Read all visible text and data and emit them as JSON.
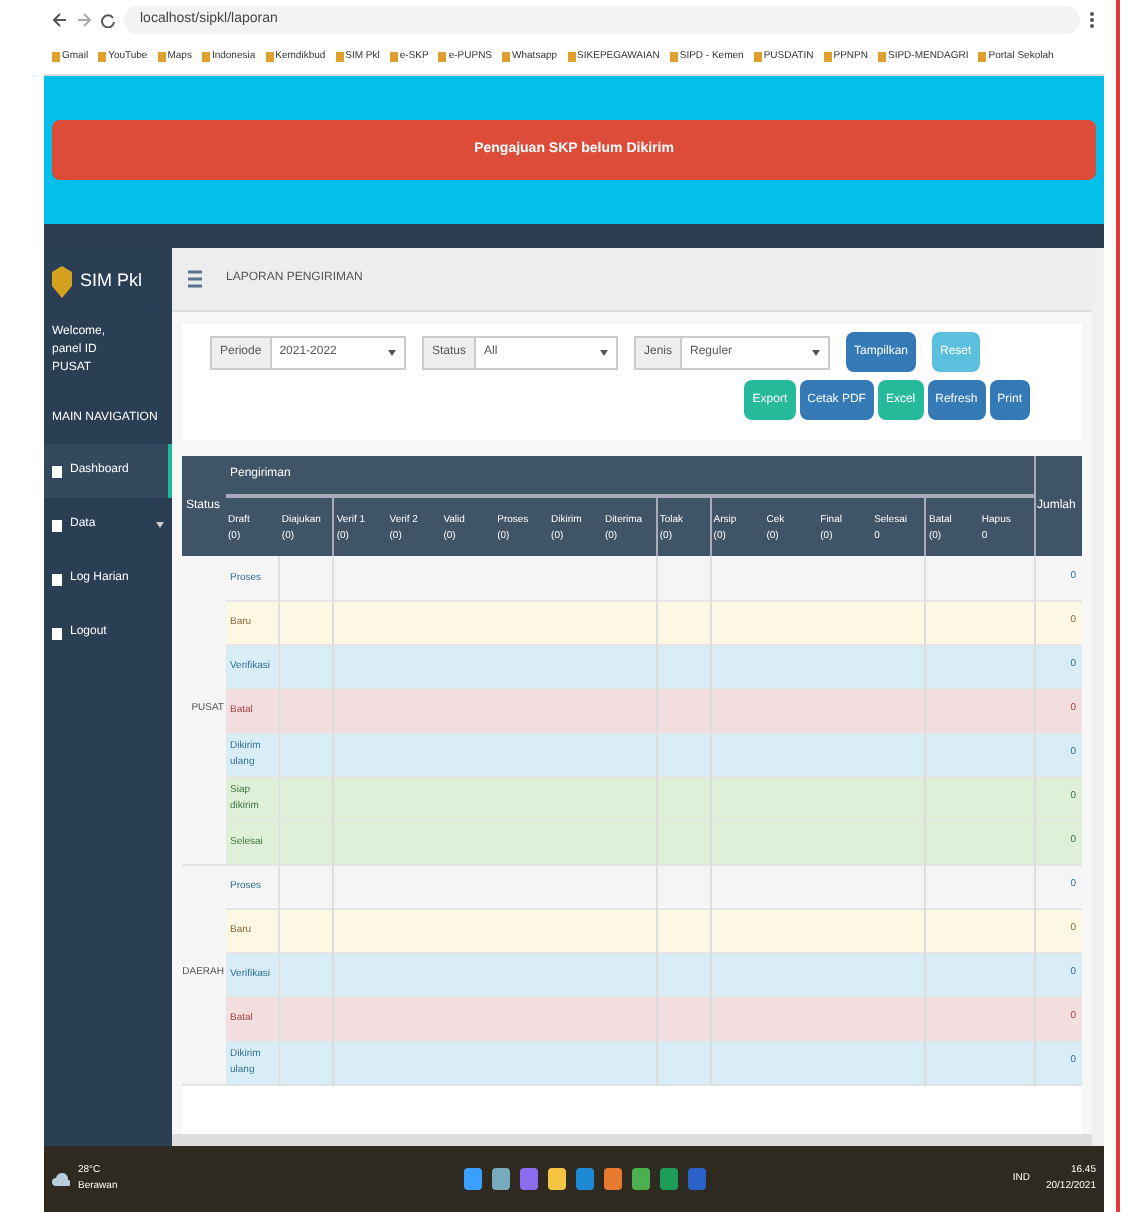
{
  "browser": {
    "url": "localhost/sipkl/laporan",
    "bookmarks": [
      "Gmail",
      "YouTube",
      "Maps",
      "Indonesia",
      "Kemdikbud",
      "SIM Pkl",
      "e-SKP",
      "e-PUPNS",
      "Whatsapp",
      "SIKEPEGAWAIAN",
      "SIPD - Kemen",
      "PUSDATIN",
      "PPNPN",
      "SIPD-MENDAGRI",
      "Portal Sekolah"
    ]
  },
  "alert": {
    "text": "Pengajuan SKP belum Dikirim"
  },
  "sidebar": {
    "brand": "SIM Pkl",
    "user": [
      "Welcome,",
      "panel ID",
      "PUSAT"
    ],
    "section": "MAIN NAVIGATION",
    "items": [
      {
        "label": "Dashboard",
        "selected": true,
        "kind": "link"
      },
      {
        "label": "Data",
        "selected": false,
        "kind": "dropdown"
      },
      {
        "label": "Log Harian",
        "selected": false,
        "kind": "link"
      },
      {
        "label": "Logout",
        "selected": false,
        "kind": "link"
      }
    ]
  },
  "page_title": "LAPORAN PENGIRIMAN",
  "filters": [
    {
      "label": "Periode",
      "value": "2021-2022"
    },
    {
      "label": "Status",
      "value": "All"
    },
    {
      "label": "Jenis",
      "value": "Reguler"
    }
  ],
  "buttons": [
    {
      "label": "Tampilkan",
      "color": "#337ab7"
    },
    {
      "label": "Reset",
      "color": "#5bc0de"
    },
    {
      "label": "Export",
      "color": "#26b99a"
    },
    {
      "label": "Cetak PDF",
      "color": "#337ab7"
    },
    {
      "label": "Excel",
      "color": "#26b99a"
    },
    {
      "label": "Refresh",
      "color": "#337ab7"
    },
    {
      "label": "Print",
      "color": "#337ab7"
    }
  ],
  "table": {
    "status_header": "Status",
    "group_header": "Pengiriman",
    "total_header": "Jumlah",
    "columns": [
      {
        "label": "Draft",
        "count": "(0)"
      },
      {
        "label": "Diajukan",
        "count": "(0)"
      },
      {
        "label": "Verif 1",
        "count": "(0)"
      },
      {
        "label": "Verif 2",
        "count": "(0)"
      },
      {
        "label": "Valid",
        "count": "(0)"
      },
      {
        "label": "Proses",
        "count": "(0)"
      },
      {
        "label": "Dikirim",
        "count": "(0)"
      },
      {
        "label": "Diterima",
        "count": "(0)"
      },
      {
        "label": "Tolak",
        "count": "(0)"
      },
      {
        "label": "Arsip",
        "count": "(0)"
      },
      {
        "label": "Cek",
        "count": "(0)"
      },
      {
        "label": "Final",
        "count": "(0)"
      },
      {
        "label": "Selesai",
        "count": "0"
      },
      {
        "label": "Batal",
        "count": "(0)"
      },
      {
        "label": "Hapus",
        "count": "0"
      }
    ],
    "groups": [
      {
        "status": "PUSAT",
        "rows": [
          {
            "label": "Proses",
            "kind": "default",
            "total": "0"
          },
          {
            "label": "Baru",
            "kind": "warning",
            "total": "0"
          },
          {
            "label": "Verifikasi",
            "kind": "info",
            "total": "0"
          },
          {
            "label": "Batal",
            "kind": "danger",
            "total": "0"
          },
          {
            "label": "Dikirim ulang",
            "kind": "info",
            "total": "0"
          },
          {
            "label": "Siap dikirim",
            "kind": "success",
            "total": "0"
          },
          {
            "label": "Selesai",
            "kind": "success",
            "total": "0"
          }
        ]
      },
      {
        "status": "DAERAH",
        "rows": [
          {
            "label": "Proses",
            "kind": "default",
            "total": "0"
          },
          {
            "label": "Baru",
            "kind": "warning",
            "total": "0"
          },
          {
            "label": "Verifikasi",
            "kind": "info",
            "total": "0"
          },
          {
            "label": "Batal",
            "kind": "danger",
            "total": "0"
          },
          {
            "label": "Dikirim ulang",
            "kind": "info",
            "total": "0"
          }
        ]
      }
    ]
  },
  "taskbar": {
    "weather": [
      "28°C",
      "Berawan"
    ],
    "tray": "IND",
    "time": "16.45",
    "date": "20/12/2021"
  }
}
